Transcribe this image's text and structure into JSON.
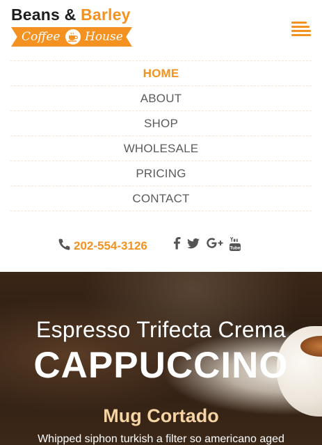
{
  "brand": {
    "name_part1": "Beans &",
    "name_part2": "Barley",
    "tagline_left": "Coffee",
    "tagline_right": "House",
    "primary_color": "#f39220"
  },
  "menu_toggle": {
    "icon": "hamburger-menu-icon"
  },
  "nav": {
    "items": [
      {
        "label": "HOME",
        "active": true
      },
      {
        "label": "ABOUT",
        "active": false
      },
      {
        "label": "SHOP",
        "active": false
      },
      {
        "label": "WHOLESALE",
        "active": false
      },
      {
        "label": "PRICING",
        "active": false
      },
      {
        "label": "CONTACT",
        "active": false
      }
    ],
    "active_color": "#f39220"
  },
  "contact": {
    "phone": "202-554-3126",
    "phone_icon": "phone-icon",
    "social": [
      {
        "icon": "facebook-icon"
      },
      {
        "icon": "twitter-icon"
      },
      {
        "icon": "google-plus-icon"
      },
      {
        "icon": "youtube-icon"
      }
    ]
  },
  "hero": {
    "subtitle": "Espresso Trifecta Crema",
    "title": "CAPPUCCINO",
    "heading": "Mug Cortado",
    "body": "Whipped siphon turkish a filter so americano aged"
  }
}
